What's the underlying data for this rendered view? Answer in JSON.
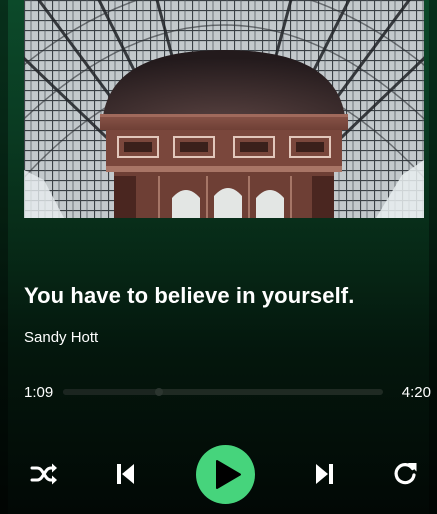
{
  "player": {
    "track_title": "You have to believe in yourself.",
    "artist": "Sandy Hott",
    "elapsed": "1:09",
    "duration": "4:20",
    "progress_fraction": 0.3
  },
  "controls": {
    "shuffle_icon": "shuffle-icon",
    "previous_icon": "skip-previous-icon",
    "play_icon": "play-icon",
    "next_icon": "skip-next-icon",
    "repeat_icon": "repeat-icon"
  },
  "colors": {
    "accent": "#46d47c",
    "background_top": "#0c4a2a",
    "background_bottom": "#020805",
    "text": "#ffffff"
  }
}
